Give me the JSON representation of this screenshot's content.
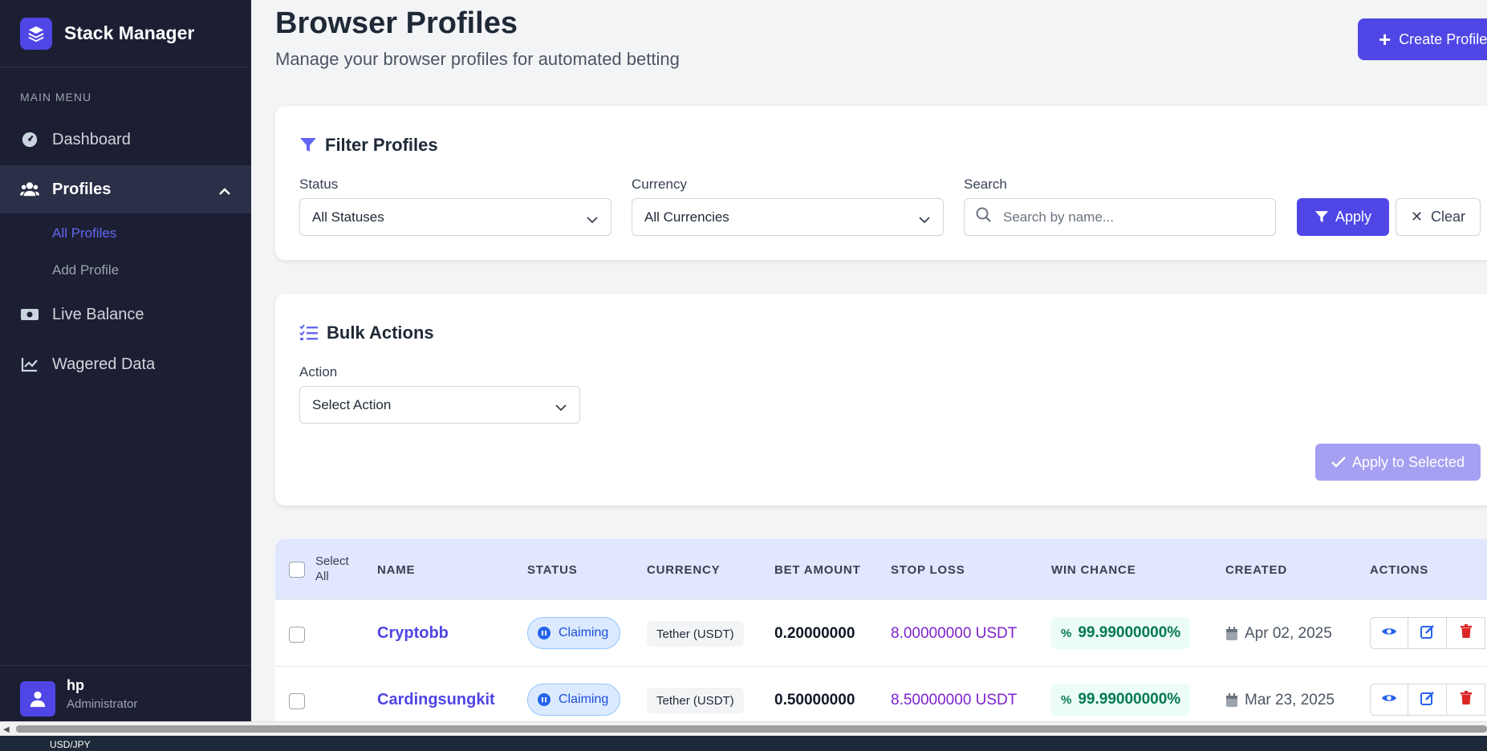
{
  "app": {
    "name": "Stack Manager"
  },
  "sidebar": {
    "menu_heading": "MAIN MENU",
    "items": [
      {
        "label": "Dashboard",
        "icon": "gauge-icon"
      },
      {
        "label": "Profiles",
        "icon": "users-icon",
        "active": true
      },
      {
        "label": "Live Balance",
        "icon": "money-icon"
      },
      {
        "label": "Wagered Data",
        "icon": "line-chart-icon"
      }
    ],
    "sub_items": [
      {
        "label": "All Profiles",
        "active": true
      },
      {
        "label": "Add Profile"
      }
    ],
    "user": {
      "name": "hp",
      "role": "Administrator"
    }
  },
  "header": {
    "title": "Browser Profiles",
    "subtitle": "Manage your browser profiles for automated betting",
    "create_label": "Create Profile"
  },
  "filter": {
    "title": "Filter Profiles",
    "status_label": "Status",
    "status_value": "All Statuses",
    "currency_label": "Currency",
    "currency_value": "All Currencies",
    "search_label": "Search",
    "search_placeholder": "Search by name...",
    "apply_label": "Apply",
    "clear_label": "Clear"
  },
  "bulk": {
    "title": "Bulk Actions",
    "action_label": "Action",
    "action_value": "Select Action",
    "apply_selected_label": "Apply to Selected"
  },
  "table": {
    "select_all_label_1": "Select",
    "select_all_label_2": "All",
    "columns": [
      "NAME",
      "STATUS",
      "CURRENCY",
      "BET AMOUNT",
      "STOP LOSS",
      "WIN CHANCE",
      "CREATED",
      "ACTIONS"
    ],
    "rows": [
      {
        "name": "Cryptobb",
        "status": "Claiming",
        "currency": "Tether (USDT)",
        "bet": "0.20000000",
        "stop_loss": "8.00000000 USDT",
        "win_chance": "99.99000000%",
        "created": "Apr 02, 2025"
      },
      {
        "name": "Cardingsungkit",
        "status": "Claiming",
        "currency": "Tether (USDT)",
        "bet": "0.50000000",
        "stop_loss": "8.50000000 USDT",
        "win_chance": "99.99000000%",
        "created": "Mar 23, 2025"
      }
    ]
  },
  "taskbar": {
    "ticker": "USD/JPY"
  },
  "colors": {
    "accent": "#4f46e5",
    "sidebar_bg": "#1c1f33",
    "stop_loss": "#7e22ce",
    "win": "#047857"
  }
}
